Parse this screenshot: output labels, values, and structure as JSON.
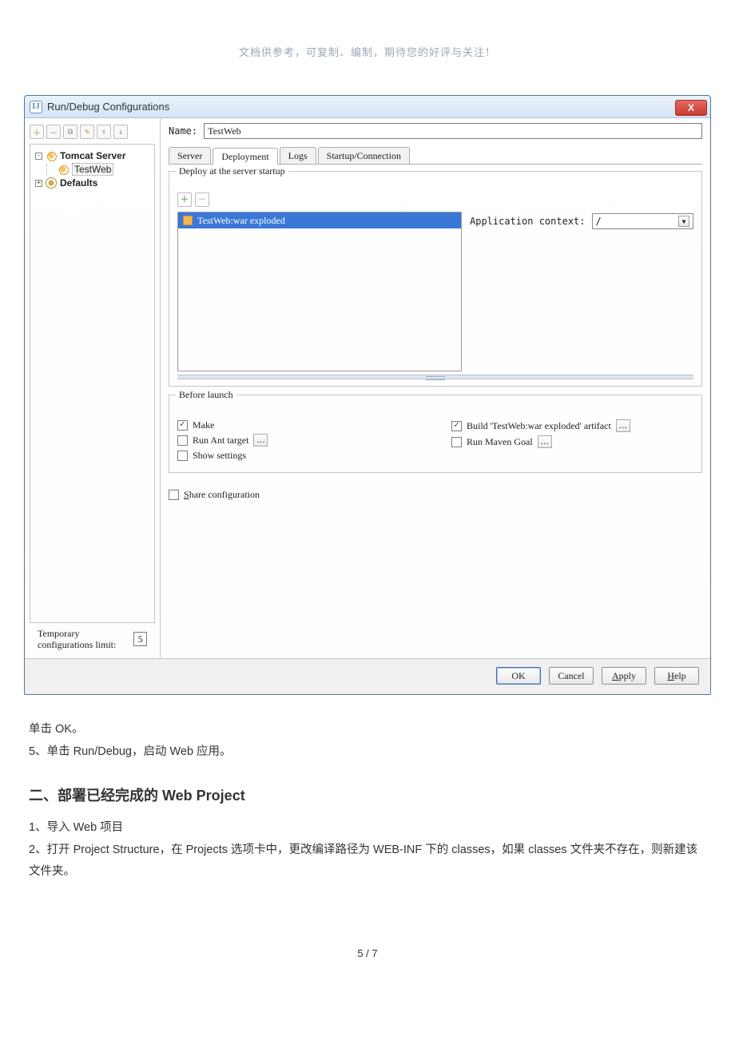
{
  "page_header_note": "文档供参考，可复制、编制，期待您的好评与关注！",
  "dialog": {
    "title": "Run/Debug Configurations",
    "close_label": "X",
    "left": {
      "tree": {
        "tomcat_label": "Tomcat Server",
        "testweb_label": "TestWeb",
        "defaults_label": "Defaults"
      },
      "temp_limit_label": "Temporary configurations limit:",
      "temp_limit_value": "5"
    },
    "right": {
      "name_label": "Name:",
      "name_value": "TestWeb",
      "tabs": {
        "server": "Server",
        "deployment": "Deployment",
        "logs": "Logs",
        "startup": "Startup/Connection"
      },
      "deploy": {
        "legend": "Deploy at the server startup",
        "artifact": "TestWeb:war exploded",
        "app_context_label": "Application context:",
        "app_context_value": "/"
      },
      "before_launch": {
        "legend": "Before launch",
        "make": "Make",
        "build_artifact": "Build 'TestWeb:war exploded' artifact",
        "run_ant": "Run Ant target",
        "run_maven": "Run Maven Goal",
        "show_settings": "Show settings"
      },
      "share_label": "Share configuration"
    },
    "footer": {
      "ok": "OK",
      "cancel": "Cancel",
      "apply": "Apply",
      "help": "Help"
    }
  },
  "body": {
    "line1": "单击 OK。",
    "line2": "5、单击 Run/Debug，启动 Web 应用。",
    "heading": "二、部署已经完成的 Web Project",
    "p1": "1、导入 Web 项目",
    "p2": "2、打开 Project Structure，在 Projects 选项卡中，更改编译路径为 WEB-INF 下的 classes，如果 classes 文件夹不存在，则新建该文件夹。"
  },
  "page_num": "5 / 7"
}
